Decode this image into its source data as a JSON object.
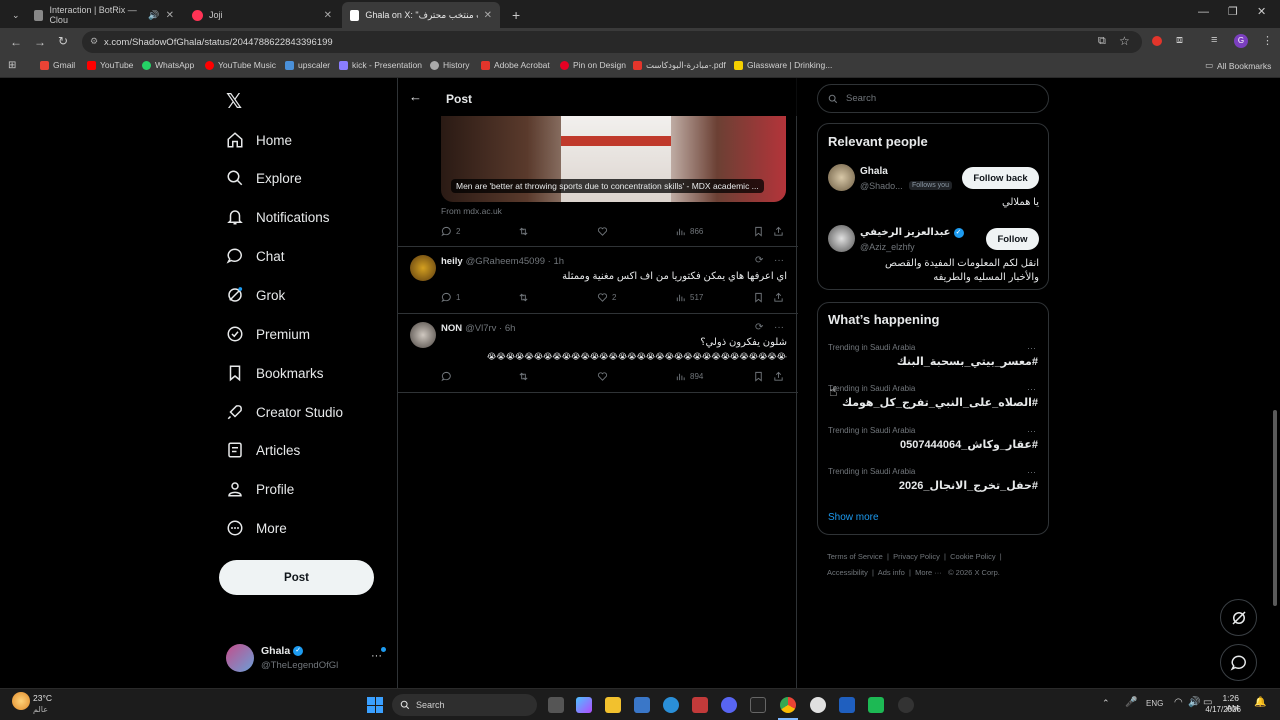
{
  "browser": {
    "tabs": [
      {
        "title": "Interaction | BotRix — Clou",
        "color": "#888888"
      },
      {
        "title": "Joji",
        "color": "#ff3355"
      },
      {
        "title": "Ghala on X: \"ألعاب منتخب محترف",
        "color": "#ffffff"
      }
    ],
    "url": "x.com/ShadowOfGhala/status/2044788622843396199",
    "bookmarks": [
      {
        "label": "Gmail",
        "color": "#ea4335"
      },
      {
        "label": "YouTube",
        "color": "#ff0000"
      },
      {
        "label": "WhatsApp",
        "color": "#25d366"
      },
      {
        "label": "YouTube Music",
        "color": "#ff0000"
      },
      {
        "label": "upscaler",
        "color": "#4a90d9"
      },
      {
        "label": "kick - Presentation",
        "color": "#8a7dff"
      },
      {
        "label": "History",
        "color": "#aaaaaa"
      },
      {
        "label": "Adobe Acrobat",
        "color": "#e3352b"
      },
      {
        "label": "Pin on Design",
        "color": "#e60023"
      },
      {
        "label": "مبادرة-البودكاست-.pdf",
        "color": "#e3352b"
      },
      {
        "label": "Glassware | Drinking...",
        "color": "#f5d000"
      }
    ],
    "all_bookmarks": "All Bookmarks"
  },
  "nav": {
    "items": [
      {
        "label": "Home",
        "icon": "home-icon"
      },
      {
        "label": "Explore",
        "icon": "search-icon"
      },
      {
        "label": "Notifications",
        "icon": "bell-icon"
      },
      {
        "label": "Chat",
        "icon": "chat-icon"
      },
      {
        "label": "Grok",
        "icon": "grok-icon"
      },
      {
        "label": "Premium",
        "icon": "premium-icon"
      },
      {
        "label": "Bookmarks",
        "icon": "bookmark-icon"
      },
      {
        "label": "Creator Studio",
        "icon": "rocket-icon"
      },
      {
        "label": "Articles",
        "icon": "article-icon"
      },
      {
        "label": "Profile",
        "icon": "profile-icon"
      },
      {
        "label": "More",
        "icon": "more-icon"
      }
    ],
    "post_button": "Post",
    "account": {
      "name": "Ghala",
      "handle": "@TheLegendOfGl"
    }
  },
  "post": {
    "header_title": "Post",
    "media_caption": "Men are 'better at throwing sports due to concentration skills' - MDX academic ...",
    "source": "From mdx.ac.uk",
    "stats": {
      "replies": "2",
      "views": "866"
    }
  },
  "replies": [
    {
      "name": "heily",
      "handle": "@GRaheem45099 · 1h",
      "text": "اي اعرفها هاي يمكن فكتوريا من اف اكس مغنية وممثلة",
      "replies": "1",
      "likes": "2",
      "views": "517"
    },
    {
      "name": "NON",
      "handle": "@Vl7rv · 6h",
      "text": "شلون يفكرون ذولي؟",
      "text2": "😭😭😭😭😭😭😭😭😭😭😭😭😭😭😭😭😭😭😭😭😭😭😭😭😭😭😭😭😭😭😭😭😭😭😭😭😭😭😭😭",
      "replies": "",
      "likes": "",
      "views": "894"
    }
  ],
  "search": {
    "placeholder": "Search"
  },
  "relevant_people": {
    "title": "Relevant people",
    "people": [
      {
        "name": "Ghala",
        "handle": "@Shado...",
        "badge": "Follows you",
        "button": "Follow back",
        "bio": "يا هملالي"
      },
      {
        "name": "عبدالعزيز الرخيفي",
        "handle": "@Aziz_elzhfy",
        "badge": "",
        "button": "Follow",
        "bio": "انقل لكم المعلومات المفيدة والقصص والأخبار المسليه والطريفه"
      }
    ]
  },
  "whats_happening": {
    "title": "What’s happening",
    "trends": [
      {
        "meta": "Trending in Saudi Arabia",
        "tag": "#معسر_بيتي_بسحبة_البنك"
      },
      {
        "meta": "Trending in Saudi Arabia",
        "tag": "#الصلاه_على_النبي_تفرج_كل_هومك"
      },
      {
        "meta": "Trending in Saudi Arabia",
        "tag": "#عقار_وكاش_0507444064"
      },
      {
        "meta": "Trending in Saudi Arabia",
        "tag": "#حفل_تخرج_الانجال_2026"
      }
    ],
    "show_more": "Show more"
  },
  "footer": {
    "links": [
      "Terms of Service",
      "Privacy Policy",
      "Cookie Policy",
      "Accessibility",
      "Ads info",
      "More ···",
      "© 2026 X Corp."
    ]
  },
  "taskbar": {
    "weather_temp": "23°C",
    "weather_text": "عالم",
    "search": "Search",
    "lang": "ENG",
    "time": "1:26 AM",
    "date": "4/17/2026"
  }
}
